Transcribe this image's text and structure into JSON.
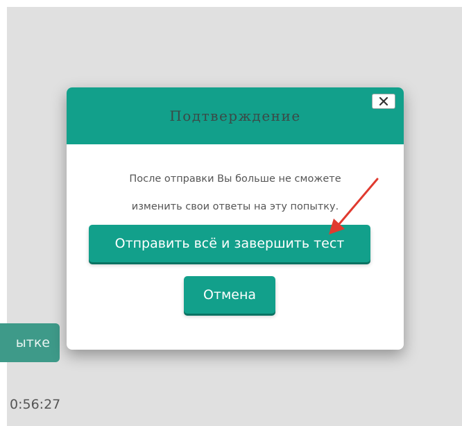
{
  "background": {
    "partial_button_label": "ытке",
    "timer": "0:56:27"
  },
  "modal": {
    "title": "Подтверждение",
    "close_icon": "close-icon",
    "message_line1": "После отправки Вы больше не сможете",
    "message_line2": "изменить свои ответы на эту попытку.",
    "submit_label": "Отправить всё и завершить тест",
    "cancel_label": "Отмена"
  },
  "annotation": {
    "arrow_color": "#e03a2f"
  },
  "colors": {
    "accent": "#12a08b",
    "backdrop": "#e0e0e0"
  }
}
